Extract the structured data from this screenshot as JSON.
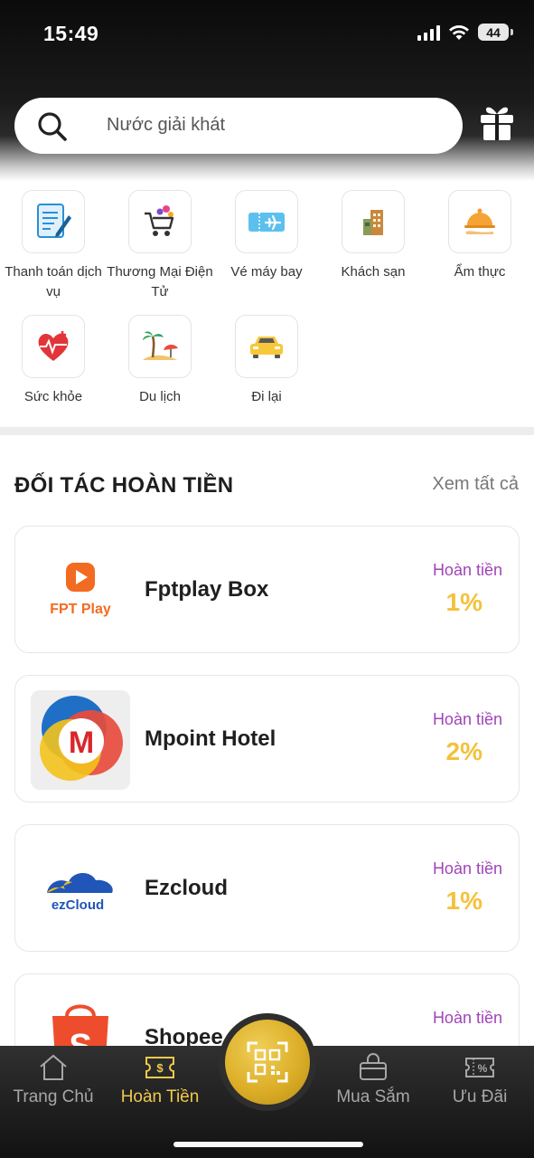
{
  "status_bar": {
    "time": "15:49",
    "battery": "44"
  },
  "search": {
    "placeholder": "Nước giải khát"
  },
  "categories": [
    {
      "label": "Thanh toán dịch vụ",
      "icon": "bill-payment-icon"
    },
    {
      "label": "Thương Mại Điện Tử",
      "icon": "shopping-cart-icon"
    },
    {
      "label": "Vé máy bay",
      "icon": "plane-ticket-icon"
    },
    {
      "label": "Khách sạn",
      "icon": "hotel-icon"
    },
    {
      "label": "Ẩm thực",
      "icon": "food-cloche-icon"
    },
    {
      "label": "Sức khỏe",
      "icon": "health-heart-icon"
    },
    {
      "label": "Du lịch",
      "icon": "beach-icon"
    },
    {
      "label": "Đi lại",
      "icon": "car-icon"
    }
  ],
  "partners": {
    "title": "ĐỐI TÁC HOÀN TIỀN",
    "see_all": "Xem tất cả",
    "items": [
      {
        "name": "Fptplay Box",
        "cashback_label": "Hoàn tiền",
        "cashback": "1%",
        "logo_text": "FPT Play"
      },
      {
        "name": "Mpoint Hotel",
        "cashback_label": "Hoàn tiền",
        "cashback": "2%",
        "logo_text": "M"
      },
      {
        "name": "Ezcloud",
        "cashback_label": "Hoàn tiền",
        "cashback": "1%",
        "logo_text": "ezCloud"
      },
      {
        "name": "Shopee",
        "cashback_label": "Hoàn tiền",
        "cashback": "",
        "logo_text": "S"
      }
    ]
  },
  "bottom_nav": [
    {
      "label": "Trang Chủ",
      "icon": "home-icon",
      "active": false
    },
    {
      "label": "Hoàn Tiền",
      "icon": "cashback-ticket-icon",
      "active": true
    },
    {
      "label": "Mua Sắm",
      "icon": "shopping-bag-icon",
      "active": false
    },
    {
      "label": "Ưu Đãi",
      "icon": "discount-voucher-icon",
      "active": false
    }
  ],
  "colors": {
    "accent": "#F4C13C",
    "cashback_label": "#A044B8",
    "nav_active": "#F2C94C",
    "header": "#111111"
  }
}
